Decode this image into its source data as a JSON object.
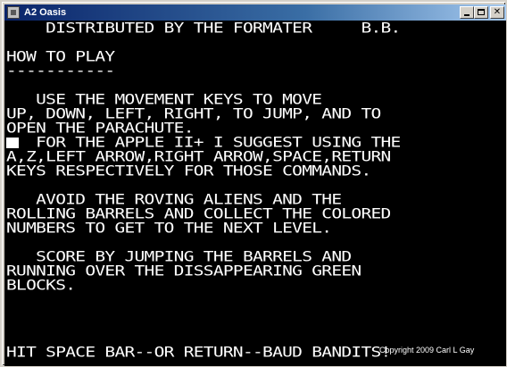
{
  "window": {
    "title": "A2 Oasis",
    "controls": {
      "minimize": "",
      "maximize": "",
      "close": "✕"
    }
  },
  "screen": {
    "lines": [
      "    DISTRIBUTED BY THE FORMATER     B.B.",
      "",
      "HOW TO PLAY",
      "-----------",
      "",
      "   USE THE MOVEMENT KEYS TO MOVE",
      "UP, DOWN, LEFT, RIGHT, TO JUMP, AND TO",
      "OPEN THE PARACHUTE.",
      "   FOR THE APPLE II+ I SUGGEST USING THE",
      "A,Z,LEFT ARROW,RIGHT ARROW,SPACE,RETURN",
      "KEYS RESPECTIVELY FOR THOSE COMMANDS.",
      "",
      "   AVOID THE ROVING ALIENS AND THE",
      "ROLLING BARRELS AND COLLECT THE COLORED",
      "NUMBERS TO GET TO THE NEXT LEVEL.",
      "",
      "   SCORE BY JUMPING THE BARRELS AND",
      "RUNNING OVER THE DISSAPPEARING GREEN",
      "BLOCKS.",
      "",
      "",
      "",
      "",
      "HIT SPACE BAR--OR RETURN--BAUD BANDITS!"
    ],
    "copyright": "Copyright 2009 Carl L Gay"
  },
  "colors": {
    "screen_background": "#000000",
    "screen_text": "#ffffff",
    "titlebar_start": "#0a246a",
    "titlebar_end": "#a6caf0"
  }
}
